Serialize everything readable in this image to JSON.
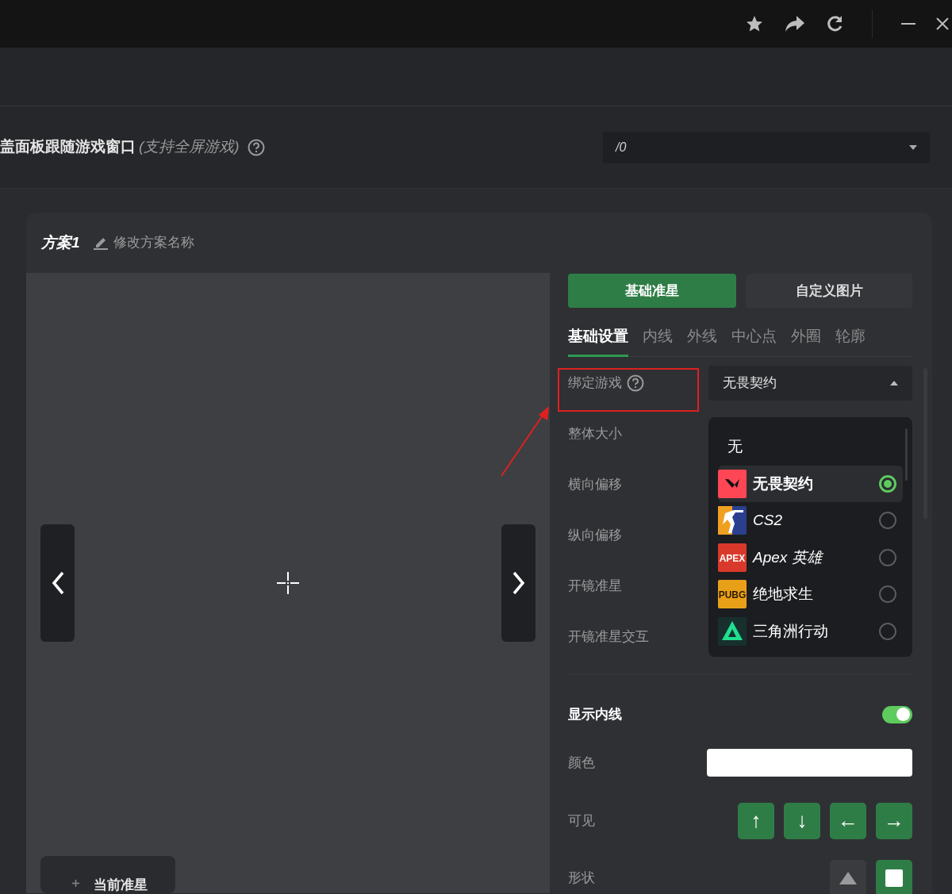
{
  "overlay_setting": {
    "label": "盖面板跟随游戏窗口",
    "note": "(支持全屏游戏)",
    "select_value": "/0"
  },
  "scheme": {
    "name": "方案1",
    "rename_label": "修改方案名称",
    "current_tab": "当前准星"
  },
  "mode_buttons": [
    {
      "label": "基础准星",
      "selected": true
    },
    {
      "label": "自定义图片",
      "selected": false
    }
  ],
  "tabs": [
    {
      "label": "基础设置",
      "selected": true
    },
    {
      "label": "内线",
      "selected": false
    },
    {
      "label": "外线",
      "selected": false
    },
    {
      "label": "中心点",
      "selected": false
    },
    {
      "label": "外圈",
      "selected": false
    },
    {
      "label": "轮廓",
      "selected": false
    }
  ],
  "bind_game": {
    "label": "绑定游戏",
    "value": "无畏契约",
    "expanded": true
  },
  "setting_rows": [
    "整体大小",
    "横向偏移",
    "纵向偏移",
    "开镜准星",
    "开镜准星交互"
  ],
  "game_options": [
    {
      "kind": "none",
      "label": "无"
    },
    {
      "kind": "mark",
      "label": "无畏契约",
      "selected": true,
      "color": "#ff4655"
    },
    {
      "kind": "figure",
      "label": "CS2",
      "selected": false,
      "color": "#2b3f8f"
    },
    {
      "kind": "wordmark",
      "label": "Apex 英雄",
      "selected": false,
      "color": "#d9392b",
      "logo_text": "APEX"
    },
    {
      "kind": "wordmark",
      "label": "绝地求生",
      "selected": false,
      "color": "#e9a019",
      "logo_text": "PUBG"
    },
    {
      "kind": "triangle",
      "label": "三角洲行动",
      "selected": false,
      "color": "#17302e"
    }
  ],
  "show_inner_line": {
    "label": "显示内线",
    "on": true
  },
  "color_row": {
    "label": "颜色",
    "color": "#ffffff"
  },
  "visible_row": {
    "label": "可见",
    "buttons": [
      {
        "label": "↑",
        "on": true
      },
      {
        "label": "↓",
        "on": true
      },
      {
        "label": "←",
        "on": true
      },
      {
        "label": "→",
        "on": true
      }
    ]
  },
  "shape_row": {
    "label": "形状",
    "options": [
      {
        "kind": "triangle",
        "selected": false
      },
      {
        "kind": "square",
        "selected": true
      }
    ]
  }
}
